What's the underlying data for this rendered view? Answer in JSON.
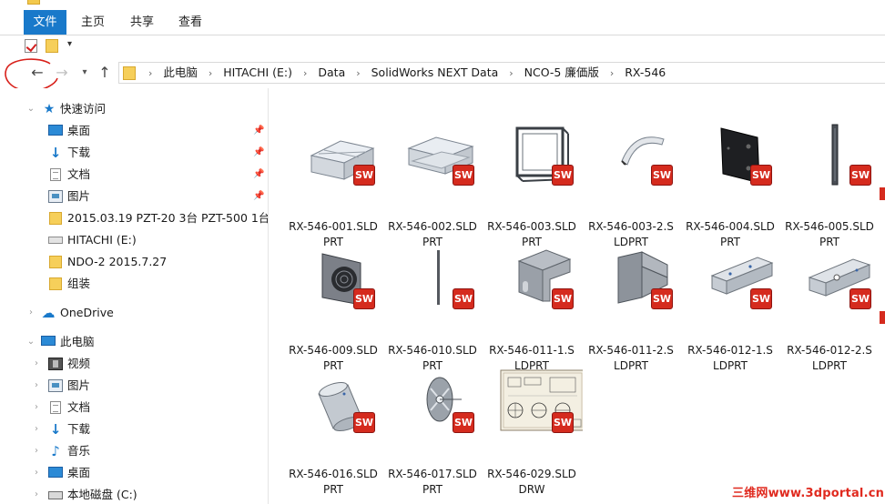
{
  "ribbon": {
    "tabs": [
      {
        "label": "文件",
        "active": true
      },
      {
        "label": "主页"
      },
      {
        "label": "共享"
      },
      {
        "label": "查看"
      }
    ],
    "accent_color": "#1979ca"
  },
  "qat": {
    "dropdown_glyph": "▾"
  },
  "address": {
    "breadcrumbs": [
      "此电脑",
      "HITACHI (E:)",
      "Data",
      "SolidWorks NEXT Data",
      "NCO-5 廉価版",
      "RX-546"
    ]
  },
  "nav": {
    "quick_access": {
      "label": "快速访问",
      "items": [
        {
          "label": "桌面",
          "icon": "desktop-icon",
          "pinned": true
        },
        {
          "label": "下载",
          "icon": "download-icon",
          "pinned": true
        },
        {
          "label": "文档",
          "icon": "document-icon",
          "pinned": true
        },
        {
          "label": "图片",
          "icon": "pictures-icon",
          "pinned": true
        },
        {
          "label": "2015.03.19 PZT-20 3台 PZT-500 1台",
          "icon": "folder-icon"
        },
        {
          "label": "HITACHI (E:)",
          "icon": "drive-icon"
        },
        {
          "label": "NDO-2 2015.7.27",
          "icon": "folder-icon"
        },
        {
          "label": "组装",
          "icon": "folder-icon"
        }
      ]
    },
    "onedrive": {
      "label": "OneDrive"
    },
    "this_pc": {
      "label": "此电脑",
      "items": [
        {
          "label": "视频",
          "icon": "video-icon"
        },
        {
          "label": "图片",
          "icon": "pictures-icon"
        },
        {
          "label": "文档",
          "icon": "document-icon"
        },
        {
          "label": "下载",
          "icon": "download-icon"
        },
        {
          "label": "音乐",
          "icon": "music-icon"
        },
        {
          "label": "桌面",
          "icon": "desktop-icon"
        },
        {
          "label": "本地磁盘 (C:)",
          "icon": "local-disk-icon"
        }
      ]
    }
  },
  "files": [
    {
      "line1": "RX-546-001.SLD",
      "line2": "PRT",
      "thumb": "bracket-box"
    },
    {
      "line1": "RX-546-002.SLD",
      "line2": "PRT",
      "thumb": "channel"
    },
    {
      "line1": "RX-546-003.SLD",
      "line2": "PRT",
      "thumb": "frame"
    },
    {
      "line1": "RX-546-003-2.S",
      "line2": "LDPRT",
      "thumb": "curved-plate"
    },
    {
      "line1": "RX-546-004.SLD",
      "line2": "PRT",
      "thumb": "black-plate"
    },
    {
      "line1": "RX-546-005.SLD",
      "line2": "PRT",
      "thumb": "bar"
    },
    {
      "line1": "RX-546-009.SLD",
      "line2": "PRT",
      "thumb": "fan-plate"
    },
    {
      "line1": "RX-546-010.SLD",
      "line2": "PRT",
      "thumb": "rod"
    },
    {
      "line1": "RX-546-011-1.S",
      "line2": "LDPRT",
      "thumb": "angle-bracket"
    },
    {
      "line1": "RX-546-011-2.S",
      "line2": "LDPRT",
      "thumb": "angle-bracket-2"
    },
    {
      "line1": "RX-546-012-1.S",
      "line2": "LDPRT",
      "thumb": "l-bracket"
    },
    {
      "line1": "RX-546-012-2.S",
      "line2": "LDPRT",
      "thumb": "l-bracket-2"
    },
    {
      "line1": "RX-546-016.SLD",
      "line2": "PRT",
      "thumb": "cylinder"
    },
    {
      "line1": "RX-546-017.SLD",
      "line2": "PRT",
      "thumb": "disc"
    },
    {
      "line1": "RX-546-029.SLD",
      "line2": "DRW",
      "thumb": "drawing"
    }
  ],
  "badge": {
    "label": "SW",
    "color": "#d52b1e"
  },
  "watermark": "三维网www.3dportal.cn"
}
